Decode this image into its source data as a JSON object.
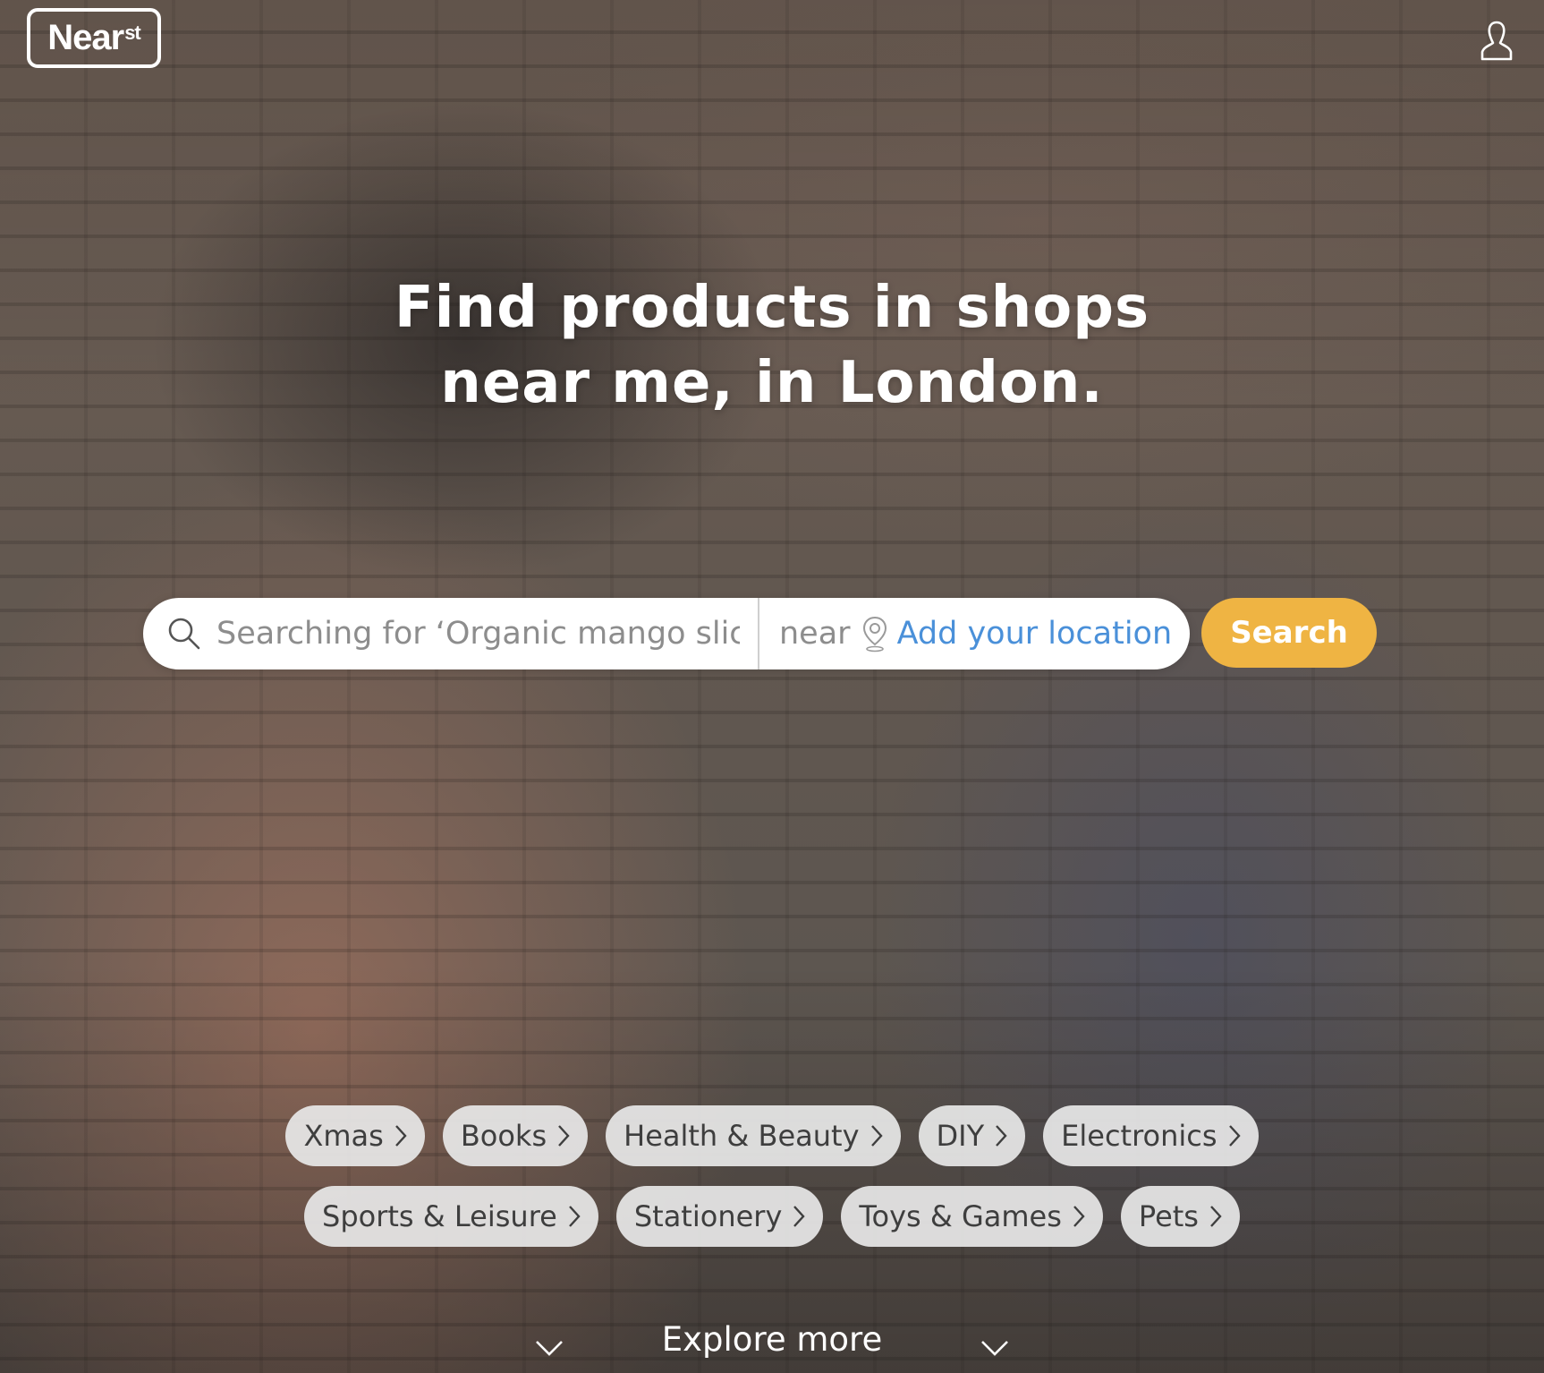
{
  "brand": {
    "logo_text": "Near",
    "logo_sup": "st"
  },
  "hero": {
    "title_line1": "Find products in shops",
    "title_line2": "near me, in London."
  },
  "search": {
    "placeholder": "Searching for ‘Organic mango slic",
    "near_label": "near",
    "location_link": "Add your location",
    "button_label": "Search"
  },
  "categories": {
    "row1": [
      "Xmas",
      "Books",
      "Health & Beauty",
      "DIY",
      "Electronics"
    ],
    "row2": [
      "Sports & Leisure",
      "Stationery",
      "Toys & Games",
      "Pets"
    ]
  },
  "explore": {
    "label": "Explore more"
  },
  "icons": {
    "profile": "user-icon",
    "search": "search-icon",
    "location": "location-pin-icon",
    "chevron": "chevron-right-icon",
    "down": "chevron-down-icon"
  },
  "colors": {
    "accent": "#efb443",
    "link": "#4a90d9",
    "chip_bg": "#e8e8e8"
  }
}
